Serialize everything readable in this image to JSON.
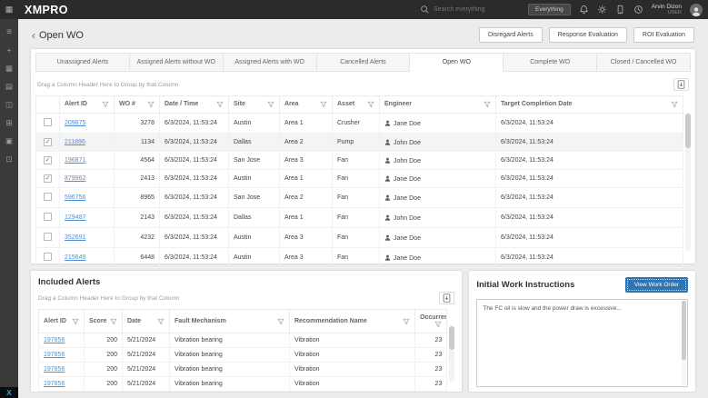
{
  "topbar": {
    "brand": "XMPRO",
    "search_placeholder": "Search everything",
    "search_scope": "Everything",
    "user_name": "Arvin Dizon",
    "user_role": "USER",
    "icons": [
      "apps-grid-icon",
      "search-icon",
      "notifications-bell-icon",
      "settings-gear-icon",
      "mobile-device-icon",
      "clock-icon",
      "avatar"
    ]
  },
  "sidebar": {
    "icons": [
      {
        "name": "menu-icon",
        "glyph": "≡"
      },
      {
        "name": "add-icon",
        "glyph": "+"
      },
      {
        "name": "dashboard-icon",
        "glyph": "▦"
      },
      {
        "name": "workflow-icon",
        "glyph": "▤"
      },
      {
        "name": "media-icon",
        "glyph": "◫"
      },
      {
        "name": "link-icon",
        "glyph": "⊞"
      },
      {
        "name": "table-icon",
        "glyph": "▣"
      },
      {
        "name": "data-grid-icon",
        "glyph": "⊡"
      }
    ],
    "logo": "X"
  },
  "page": {
    "back_glyph": "‹",
    "title": "Open WO",
    "actions": [
      "Disregard Alerts",
      "Response Evaluation",
      "ROI Evaluation"
    ]
  },
  "tabs": [
    {
      "label": "Unassigned Alerts",
      "active": false
    },
    {
      "label": "Assigned Alerts without WO",
      "active": false
    },
    {
      "label": "Assigned Alerts with WO",
      "active": false
    },
    {
      "label": "Cancelled Alerts",
      "active": false
    },
    {
      "label": "Open WO",
      "active": true
    },
    {
      "label": "Complete WO",
      "active": false
    },
    {
      "label": "Closed / Cancelled WO",
      "active": false
    }
  ],
  "main_table": {
    "group_hint": "Drag a Column Header Here to Group by that Column",
    "columns": [
      "Alert ID",
      "WO #",
      "Date / Time",
      "Site",
      "Area",
      "Asset",
      "Engineer",
      "Target Completion Date"
    ],
    "rows": [
      {
        "checked": false,
        "highlighted": false,
        "alert_id": "209875",
        "wo_number": "3278",
        "date_time": "6/3/2024, 11:53:24",
        "site": "Austin",
        "area": "Area 1",
        "asset": "Crusher",
        "engineer": "Jane Doe",
        "target_completion_date": "6/3/2024, 11:53:24"
      },
      {
        "checked": true,
        "highlighted": true,
        "alert_id": "211896",
        "wo_number": "1134",
        "date_time": "6/3/2024, 11:53:24",
        "site": "Dallas",
        "area": "Area 2",
        "asset": "Pump",
        "engineer": "John Doe",
        "target_completion_date": "6/3/2024, 11:53:24"
      },
      {
        "checked": true,
        "highlighted": false,
        "alert_id": "196871",
        "wo_number": "4564",
        "date_time": "6/3/2024, 11:53:24",
        "site": "San Jose",
        "area": "Area 3",
        "asset": "Fan",
        "engineer": "John Doe",
        "target_completion_date": "6/3/2024, 11:53:24"
      },
      {
        "checked": true,
        "highlighted": false,
        "alert_id": "879962",
        "wo_number": "2413",
        "date_time": "6/3/2024, 11:53:24",
        "site": "Austin",
        "area": "Area 1",
        "asset": "Fan",
        "engineer": "Jane Doe",
        "target_completion_date": "6/3/2024, 11:53:24"
      },
      {
        "checked": false,
        "highlighted": false,
        "alert_id": "596756",
        "wo_number": "8965",
        "date_time": "6/3/2024, 11:53:24",
        "site": "San Jose",
        "area": "Area 2",
        "asset": "Fan",
        "engineer": "Jane Doe",
        "target_completion_date": "6/3/2024, 11:53:24"
      },
      {
        "checked": false,
        "highlighted": false,
        "alert_id": "129487",
        "wo_number": "2143",
        "date_time": "6/3/2024, 11:53:24",
        "site": "Dallas",
        "area": "Area 1",
        "asset": "Fan",
        "engineer": "John Doe",
        "target_completion_date": "6/3/2024, 11:53:24"
      },
      {
        "checked": false,
        "highlighted": false,
        "alert_id": "352691",
        "wo_number": "4232",
        "date_time": "6/3/2024, 11:53:24",
        "site": "Austin",
        "area": "Area 3",
        "asset": "Fan",
        "engineer": "Jane Doe",
        "target_completion_date": "6/3/2024, 11:53:24"
      },
      {
        "checked": false,
        "highlighted": false,
        "alert_id": "215649",
        "wo_number": "6448",
        "date_time": "6/3/2024, 11:53:24",
        "site": "Austin",
        "area": "Area 3",
        "asset": "Fan",
        "engineer": "Jane Doe",
        "target_completion_date": "6/3/2024, 11:53:24"
      }
    ]
  },
  "included_alerts": {
    "title": "Included Alerts",
    "group_hint": "Drag a Column Header Here to Group by that Column",
    "columns": [
      "Alert ID",
      "Score",
      "Date",
      "Fault Mechanism",
      "Recommendation Name",
      "Occurrences"
    ],
    "rows": [
      {
        "alert_id": "197856",
        "score": "200",
        "date": "5/21/2024",
        "fault_mechanism": "Vibration bearing",
        "recommendation_name": "Vibration",
        "occurrences": "23"
      },
      {
        "alert_id": "197856",
        "score": "200",
        "date": "5/21/2024",
        "fault_mechanism": "Vibration bearing",
        "recommendation_name": "Vibration",
        "occurrences": "23"
      },
      {
        "alert_id": "197856",
        "score": "200",
        "date": "5/21/2024",
        "fault_mechanism": "Vibration bearing",
        "recommendation_name": "Vibration",
        "occurrences": "23"
      },
      {
        "alert_id": "197856",
        "score": "200",
        "date": "5/21/2024",
        "fault_mechanism": "Vibration bearing",
        "recommendation_name": "Vibration",
        "occurrences": "23"
      }
    ]
  },
  "work_instructions": {
    "title": "Initial Work Instructions",
    "button": "View Work Order",
    "text": "The FC oil is slow and the power draw is excessive..."
  },
  "colors": {
    "topbar_bg": "#2b2b2b",
    "sidebar_bg": "#3a3a3a",
    "page_bg": "#ececec",
    "link_blue": "#4a90d9",
    "primary_button_blue": "#2e76b3",
    "sidebar_logo_blue": "#2da0dd"
  }
}
